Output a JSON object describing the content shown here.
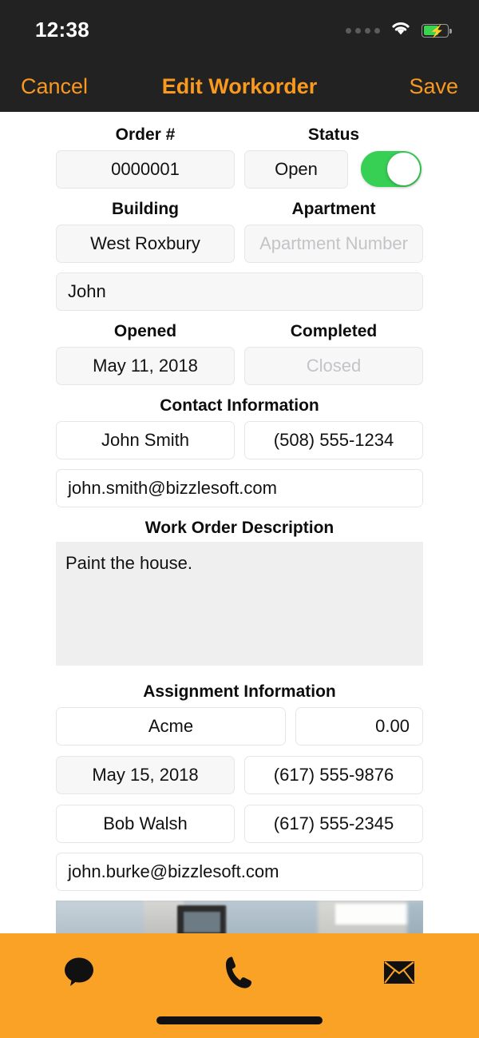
{
  "status_bar": {
    "time": "12:38",
    "signal_icon": "signal-dots-icon",
    "wifi_icon": "wifi-icon",
    "battery_icon": "battery-charging-icon"
  },
  "nav_bar": {
    "cancel_label": "Cancel",
    "title": "Edit Workorder",
    "save_label": "Save",
    "accent_color": "#F9991E",
    "background_color": "#222222"
  },
  "form": {
    "order_section": {
      "order_label": "Order #",
      "order_value": "0000001",
      "status_label": "Status",
      "status_value": "Open",
      "status_toggle_on": true,
      "toggle_color": "#38CF55"
    },
    "location_section": {
      "building_label": "Building",
      "building_value": "West Roxbury",
      "apartment_label": "Apartment",
      "apartment_placeholder": "Apartment Number",
      "tenant_value": "John"
    },
    "dates_section": {
      "opened_label": "Opened",
      "opened_value": "May 11, 2018",
      "completed_label": "Completed",
      "completed_placeholder": "Closed"
    },
    "contact_section": {
      "heading": "Contact Information",
      "name_value": "John Smith",
      "phone_value": "(508) 555-1234",
      "email_value": "john.smith@bizzlesoft.com"
    },
    "description_section": {
      "heading": "Work Order Description",
      "text": "Paint the house."
    },
    "assignment_section": {
      "heading": "Assignment Information",
      "vendor_value": "Acme",
      "amount_value": "0.00",
      "date_value": "May 15, 2018",
      "vendor_phone_value": "(617) 555-9876",
      "contact_name_value": "Bob Walsh",
      "contact_phone_value": "(617) 555-2345",
      "email_value": "john.burke@bizzlesoft.com"
    }
  },
  "toolbar": {
    "background_color": "#FAA226",
    "buttons": [
      {
        "name": "message-icon",
        "label": "Message"
      },
      {
        "name": "phone-icon",
        "label": "Call"
      },
      {
        "name": "email-icon",
        "label": "Email"
      }
    ]
  }
}
